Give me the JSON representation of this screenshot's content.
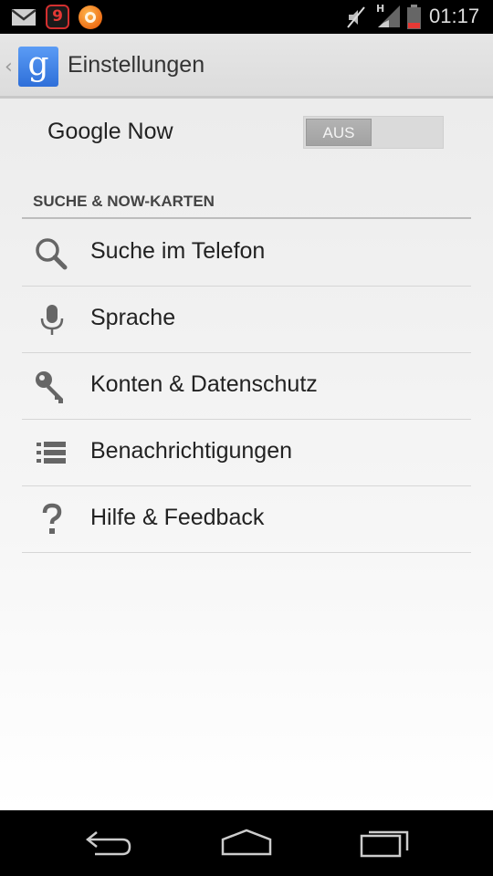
{
  "status_bar": {
    "clock": "01:17",
    "network_type": "H",
    "notification_badge": "9",
    "icons": [
      "mail-icon",
      "notification-nine-icon",
      "orange-app-icon",
      "mute-icon",
      "signal-icon",
      "battery-icon"
    ]
  },
  "action_bar": {
    "back_glyph": "‹",
    "logo_letter": "g",
    "title": "Einstellungen"
  },
  "google_now": {
    "label": "Google Now",
    "toggle_state": "AUS"
  },
  "section": {
    "header": "SUCHE & NOW-KARTEN"
  },
  "menu": {
    "items": [
      {
        "label": "Suche im Telefon",
        "icon": "search-icon"
      },
      {
        "label": "Sprache",
        "icon": "microphone-icon"
      },
      {
        "label": "Konten & Datenschutz",
        "icon": "key-icon"
      },
      {
        "label": "Benachrichtigungen",
        "icon": "list-icon"
      },
      {
        "label": "Hilfe & Feedback",
        "icon": "help-icon"
      }
    ]
  },
  "nav_bar": {
    "buttons": [
      "back-icon",
      "home-icon",
      "recents-icon"
    ]
  },
  "colors": {
    "google_blue": "#2f6fd9",
    "status_bar_bg": "#000000",
    "text_primary": "#222222"
  }
}
